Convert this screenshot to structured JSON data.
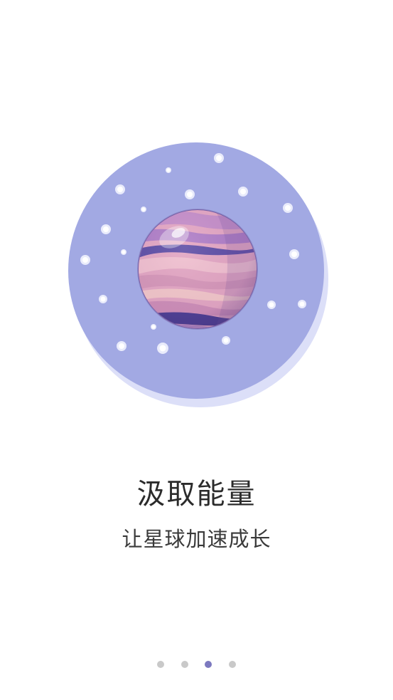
{
  "onboarding": {
    "title": "汲取能量",
    "subtitle": "让星球加速成长",
    "illustration_icon": "planet-illustration-icon",
    "page_indicator": {
      "total": 4,
      "current": 3
    }
  },
  "colors": {
    "circle_bg": "#A2A9E3",
    "circle_shadow": "#DCDFF8",
    "dot_active": "#7C79BF",
    "dot_inactive": "#C9C9C9",
    "text_primary": "#2B2B2B"
  }
}
